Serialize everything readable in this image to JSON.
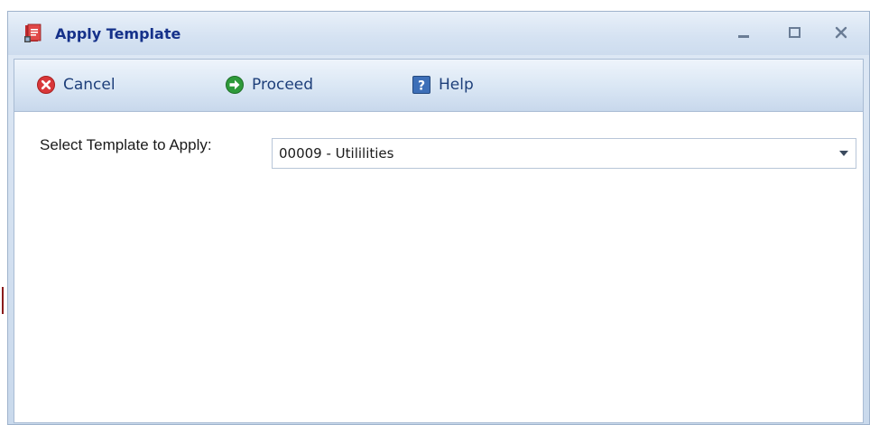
{
  "window": {
    "title": "Apply Template",
    "controls": {
      "minimize_icon": "minimize-icon",
      "maximize_icon": "maximize-icon",
      "close_icon": "close-icon"
    }
  },
  "toolbar": {
    "cancel_label": "Cancel",
    "proceed_label": "Proceed",
    "help_label": "Help",
    "cancel_color": "#d9373a",
    "proceed_color": "#2e9a3a",
    "help_color": "#2f5fa6"
  },
  "form": {
    "template_label": "Select Template to Apply:",
    "template_value": "00009 - Utililities"
  },
  "theme": {
    "title_color": "#15318a",
    "toolbar_text_color": "#1e3f7a"
  }
}
